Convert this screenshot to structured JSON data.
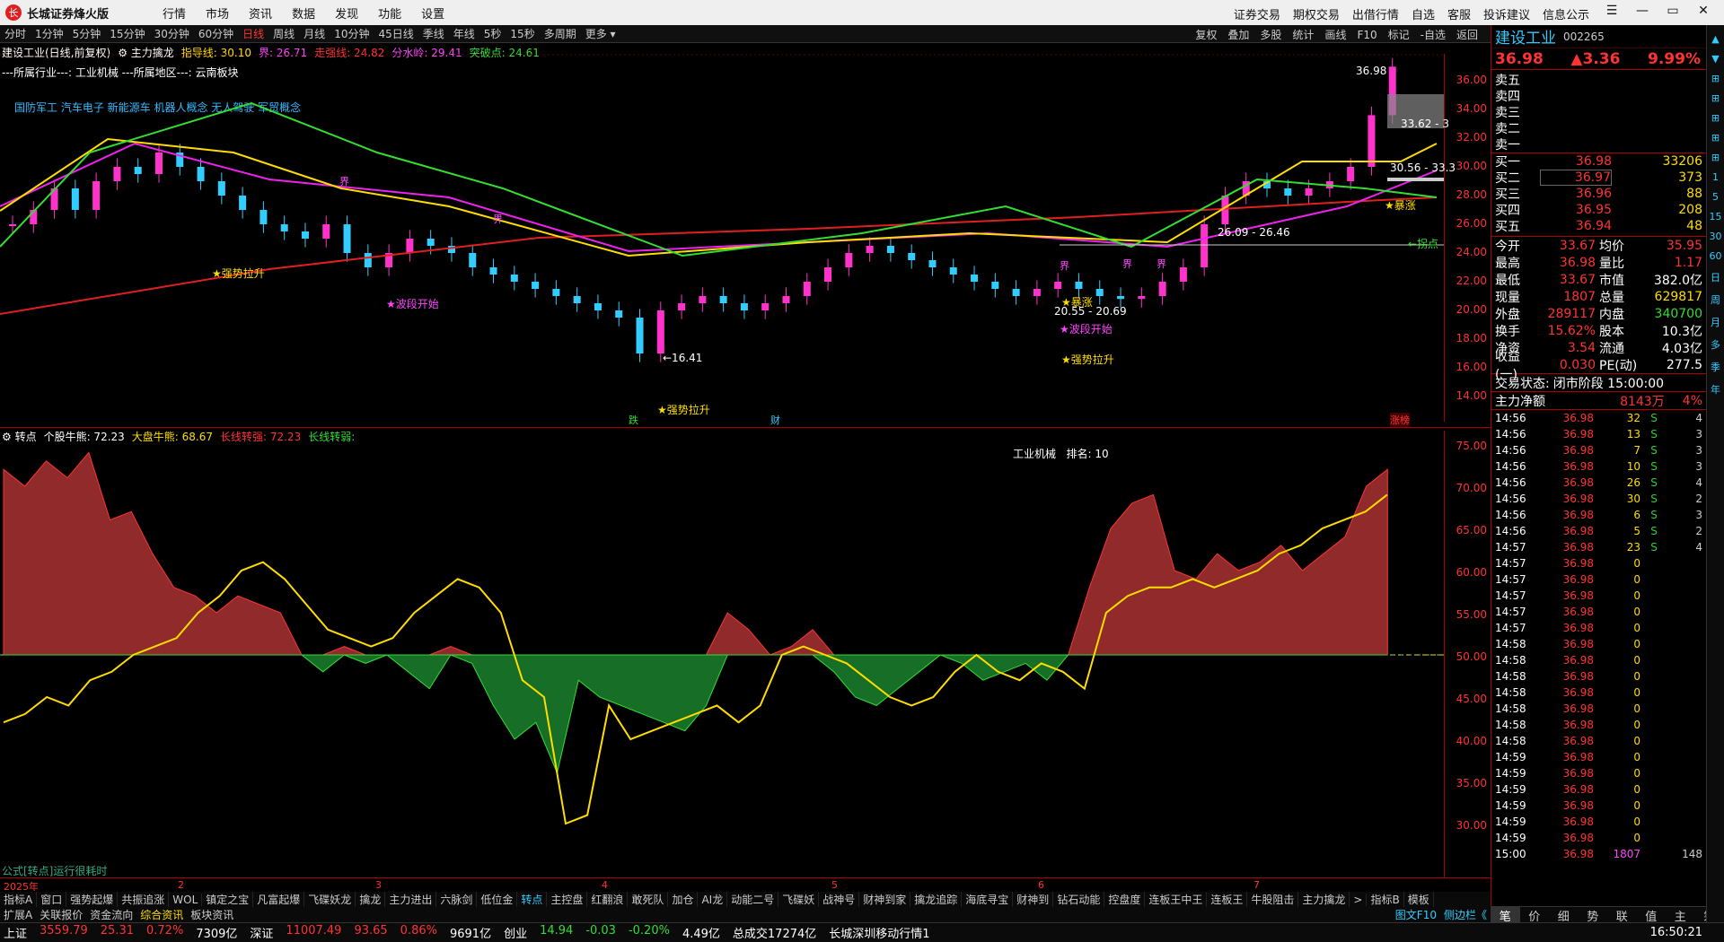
{
  "app": {
    "title": "长城证券烽火版",
    "logo": "长",
    "menu": [
      "行情",
      "市场",
      "资讯",
      "数据",
      "发现",
      "功能",
      "设置"
    ],
    "right_menu": [
      "证券交易",
      "期权交易",
      "出借行情",
      "自选",
      "客服",
      "投诉建议",
      "信息公示"
    ]
  },
  "periods": [
    "分时",
    "1分钟",
    "5分钟",
    "15分钟",
    "30分钟",
    "60分钟",
    "日线",
    "周线",
    "月线",
    "10分钟",
    "45日线",
    "季线",
    "年线",
    "5秒",
    "15秒",
    "多周期",
    "更多 ▾"
  ],
  "active_period": "日线",
  "chart_tools": [
    "复权",
    "叠加",
    "多股",
    "统计",
    "画线",
    "F10",
    "标记",
    "-自选",
    "返回"
  ],
  "info_line1": [
    {
      "t": "建设工业(日线,前复权)",
      "c": "#ffffff"
    },
    {
      "t": "⚙ 主力擒龙",
      "c": "#ffffff"
    },
    {
      "t": "指导线: 30.10",
      "c": "#ffdd00"
    },
    {
      "t": "界: 26.71",
      "c": "#ff44ff"
    },
    {
      "t": "走强线: 24.82",
      "c": "#ff3333"
    },
    {
      "t": "分水岭: 29.41",
      "c": "#ff44ff"
    },
    {
      "t": "突破点: 24.61",
      "c": "#33dd33"
    }
  ],
  "info_line2": "---所属行业---: 工业机械     ---所属地区---: 云南板块",
  "concepts": "国防军工 汽车电子 新能源车 机器人概念 无人驾驶 军贸概念",
  "annotations": {
    "high_label": "36.98",
    "low_label": "←16.41",
    "box1": "33.62 - 3",
    "box2": "30.56 - 33.3",
    "box3": "26.09 - 26.46",
    "box4": "20.55 - 20.69",
    "s1": "★强势拉升",
    "s2": "★波段开始",
    "s3": "★强势拉升",
    "s4": "★暴涨",
    "s5": "★波段开始",
    "s6": "★强势拉升",
    "s7": "★暴涨",
    "s8": "←拐点",
    "jie": "界",
    "die": "跌",
    "cai": "财",
    "zhangting": "涨榜"
  },
  "price_axis": [
    "36.00",
    "34.00",
    "32.00",
    "30.00",
    "28.00",
    "26.00",
    "24.00",
    "22.00",
    "20.00",
    "18.00",
    "16.00",
    "14.00"
  ],
  "indicator_info": [
    {
      "t": "⚙ 转点",
      "c": "#ffffff"
    },
    {
      "t": "个股牛熊: 72.23",
      "c": "#ffffff"
    },
    {
      "t": "大盘牛熊: 68.67",
      "c": "#ffdd00"
    },
    {
      "t": "长线转强: 72.23",
      "c": "#ff3333"
    },
    {
      "t": "长线转弱:",
      "c": "#33dd33"
    }
  ],
  "industry_rank": {
    "industry": "工业机械",
    "rank_label": "排名:",
    "rank": "10"
  },
  "formula_note": "公式[转点]运行很耗时",
  "indicator_axis": [
    "75.00",
    "70.00",
    "65.00",
    "60.00",
    "55.00",
    "50.00",
    "45.00",
    "40.00",
    "35.00",
    "30.00"
  ],
  "time_axis": [
    "2025年",
    "2",
    "3",
    "4",
    "5",
    "6",
    "7"
  ],
  "bottom_tabs": [
    "指标A",
    "窗口",
    "强势起爆",
    "共振追涨",
    "WOL",
    "镇定之宝",
    "凡富起爆",
    "飞碟妖龙",
    "擒龙",
    "主力进出",
    "六脉剑",
    "低位金",
    "转点",
    "主控盘",
    "红翻浪",
    "敢死队",
    "加仓",
    "AI龙",
    "动能二号",
    "飞碟妖",
    "战神号",
    "财神到家",
    "擒龙追踪",
    "海底寻宝",
    "财神到",
    "钻石动能",
    "控盘度",
    "连板王中王",
    "连板王",
    "牛股阻击",
    "主力擒龙",
    ">",
    "指标B",
    "模板"
  ],
  "active_tab": "转点",
  "bottom_tabs2": [
    "扩展A",
    "关联报价",
    "资金流向",
    "综合资讯",
    "板块资讯"
  ],
  "active_tab2": "综合资讯",
  "bottom_right": [
    "图文F10",
    "侧边栏《"
  ],
  "status": [
    {
      "t": "上证",
      "c": "#ffffff"
    },
    {
      "t": "3559.79",
      "c": "#ff3333"
    },
    {
      "t": "25.31",
      "c": "#ff3333"
    },
    {
      "t": "0.72%",
      "c": "#ff3333"
    },
    {
      "t": "7309亿",
      "c": "#ffffff"
    },
    {
      "t": "深证",
      "c": "#ffffff"
    },
    {
      "t": "11007.49",
      "c": "#ff3333"
    },
    {
      "t": "93.65",
      "c": "#ff3333"
    },
    {
      "t": "0.86%",
      "c": "#ff3333"
    },
    {
      "t": "9691亿",
      "c": "#ffffff"
    },
    {
      "t": "创业",
      "c": "#ffffff"
    },
    {
      "t": "14.94",
      "c": "#33dd33"
    },
    {
      "t": "-0.03",
      "c": "#33dd33"
    },
    {
      "t": "-0.20%",
      "c": "#33dd33"
    },
    {
      "t": "4.49亿",
      "c": "#ffffff"
    },
    {
      "t": "总成交17274亿",
      "c": "#ffffff"
    },
    {
      "t": "长城深圳移动行情1",
      "c": "#ffffff"
    }
  ],
  "clock": "16:50:21",
  "stock": {
    "name": "建设工业",
    "code": "002265",
    "price": "36.98",
    "change": "▲3.36",
    "pct": "9.99%"
  },
  "order_book": {
    "asks": [
      {
        "k": "卖五",
        "v": "",
        "q": ""
      },
      {
        "k": "卖四",
        "v": "",
        "q": ""
      },
      {
        "k": "卖三",
        "v": "",
        "q": ""
      },
      {
        "k": "卖二",
        "v": "",
        "q": ""
      },
      {
        "k": "卖一",
        "v": "",
        "q": ""
      }
    ],
    "bids": [
      {
        "k": "买一",
        "v": "36.98",
        "q": "33206"
      },
      {
        "k": "买二",
        "v": "36.97",
        "q": "373"
      },
      {
        "k": "买三",
        "v": "36.96",
        "q": "88"
      },
      {
        "k": "买四",
        "v": "36.95",
        "q": "208"
      },
      {
        "k": "买五",
        "v": "36.94",
        "q": "48"
      }
    ]
  },
  "quote": [
    {
      "k": "今开",
      "v": "33.67",
      "k2": "均价",
      "v2": "35.95",
      "c2": "#ff3333"
    },
    {
      "k": "最高",
      "v": "36.98",
      "k2": "量比",
      "v2": "1.17",
      "c2": "#ff3333"
    },
    {
      "k": "最低",
      "v": "33.67",
      "k2": "市值",
      "v2": "382.0亿",
      "c2": "#ffffff"
    },
    {
      "k": "现量",
      "v": "1807",
      "k2": "总量",
      "v2": "629817",
      "c2": "#ffdd00"
    },
    {
      "k": "外盘",
      "v": "289117",
      "k2": "内盘",
      "v2": "340700",
      "c2": "#33dd33"
    },
    {
      "k": "换手",
      "v": "15.62%",
      "k2": "股本",
      "v2": "10.3亿",
      "c2": "#ffffff"
    },
    {
      "k": "净资",
      "v": "3.54",
      "k2": "流通",
      "v2": "4.03亿",
      "c2": "#ffffff"
    },
    {
      "k": "收益(一)",
      "v": "0.030",
      "k2": "PE(动)",
      "v2": "277.5",
      "c2": "#ffffff"
    }
  ],
  "trade_status": {
    "label": "交易状态:",
    "value": "闭市阶段 15:00:00"
  },
  "main_net": {
    "label": "主力净额",
    "value": "8143万",
    "pct": "4%"
  },
  "ticks": [
    {
      "t": "14:56",
      "p": "36.98",
      "q": "32",
      "s": "S",
      "n": "4"
    },
    {
      "t": "14:56",
      "p": "36.98",
      "q": "13",
      "s": "S",
      "n": "3"
    },
    {
      "t": "14:56",
      "p": "36.98",
      "q": "7",
      "s": "S",
      "n": "3"
    },
    {
      "t": "14:56",
      "p": "36.98",
      "q": "10",
      "s": "S",
      "n": "3"
    },
    {
      "t": "14:56",
      "p": "36.98",
      "q": "26",
      "s": "S",
      "n": "4"
    },
    {
      "t": "14:56",
      "p": "36.98",
      "q": "30",
      "s": "S",
      "n": "2"
    },
    {
      "t": "14:56",
      "p": "36.98",
      "q": "6",
      "s": "S",
      "n": "3"
    },
    {
      "t": "14:56",
      "p": "36.98",
      "q": "5",
      "s": "S",
      "n": "2"
    },
    {
      "t": "14:57",
      "p": "36.98",
      "q": "23",
      "s": "S",
      "n": "4"
    },
    {
      "t": "14:57",
      "p": "36.98",
      "q": "0",
      "s": "",
      "n": ""
    },
    {
      "t": "14:57",
      "p": "36.98",
      "q": "0",
      "s": "",
      "n": ""
    },
    {
      "t": "14:57",
      "p": "36.98",
      "q": "0",
      "s": "",
      "n": ""
    },
    {
      "t": "14:57",
      "p": "36.98",
      "q": "0",
      "s": "",
      "n": ""
    },
    {
      "t": "14:57",
      "p": "36.98",
      "q": "0",
      "s": "",
      "n": ""
    },
    {
      "t": "14:58",
      "p": "36.98",
      "q": "0",
      "s": "",
      "n": ""
    },
    {
      "t": "14:58",
      "p": "36.98",
      "q": "0",
      "s": "",
      "n": ""
    },
    {
      "t": "14:58",
      "p": "36.98",
      "q": "0",
      "s": "",
      "n": ""
    },
    {
      "t": "14:58",
      "p": "36.98",
      "q": "0",
      "s": "",
      "n": ""
    },
    {
      "t": "14:58",
      "p": "36.98",
      "q": "0",
      "s": "",
      "n": ""
    },
    {
      "t": "14:58",
      "p": "36.98",
      "q": "0",
      "s": "",
      "n": ""
    },
    {
      "t": "14:58",
      "p": "36.98",
      "q": "0",
      "s": "",
      "n": ""
    },
    {
      "t": "14:59",
      "p": "36.98",
      "q": "0",
      "s": "",
      "n": ""
    },
    {
      "t": "14:59",
      "p": "36.98",
      "q": "0",
      "s": "",
      "n": ""
    },
    {
      "t": "14:59",
      "p": "36.98",
      "q": "0",
      "s": "",
      "n": ""
    },
    {
      "t": "14:59",
      "p": "36.98",
      "q": "0",
      "s": "",
      "n": ""
    },
    {
      "t": "14:59",
      "p": "36.98",
      "q": "0",
      "s": "",
      "n": ""
    },
    {
      "t": "14:59",
      "p": "36.98",
      "q": "0",
      "s": "",
      "n": ""
    },
    {
      "t": "15:00",
      "p": "36.98",
      "q": "1807",
      "s": "",
      "n": "148"
    }
  ],
  "right_tabs": [
    "笔",
    "价",
    "细",
    "势",
    "联",
    "值",
    "主",
    "筹"
  ],
  "side_bar": [
    "1",
    "5",
    "15",
    "30",
    "60",
    "日",
    "周",
    "月",
    "多",
    "季",
    "年"
  ],
  "colors": {
    "up": "#ff3333",
    "down": "#33dd33",
    "accent": "#33ccff",
    "yellow": "#ffdd00",
    "magenta": "#ff44ff",
    "bg": "#000000"
  }
}
